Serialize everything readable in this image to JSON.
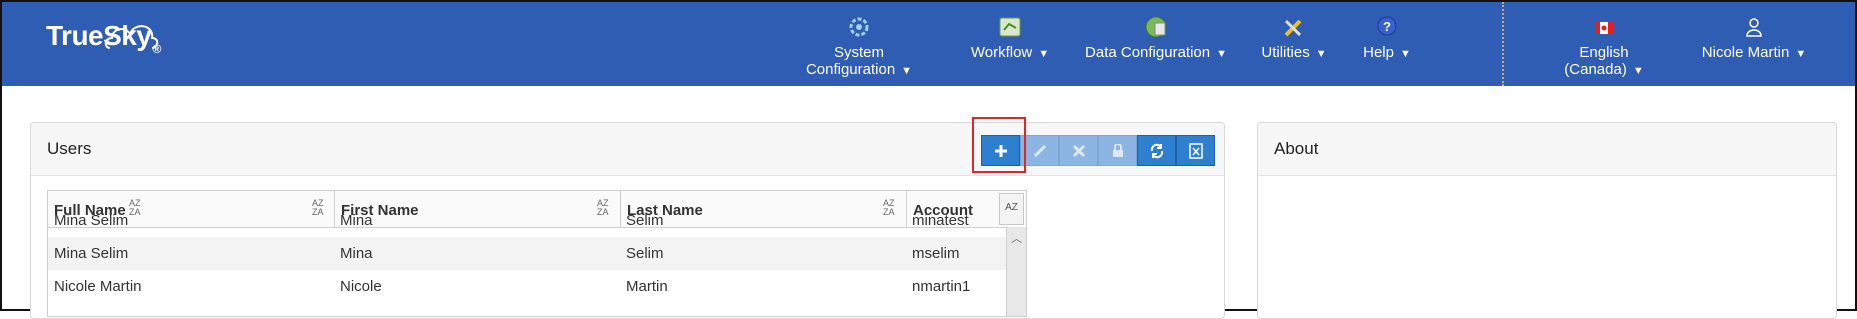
{
  "brand": {
    "name": "TrueSky",
    "reg": "®"
  },
  "nav": [
    {
      "label": "System Configuration",
      "icon": "gear-clock-icon"
    },
    {
      "label": "Workflow",
      "icon": "workflow-icon"
    },
    {
      "label": "Data Configuration",
      "icon": "database-globe-icon"
    },
    {
      "label": "Utilities",
      "icon": "tools-icon"
    },
    {
      "label": "Help",
      "icon": "help-icon"
    }
  ],
  "language": {
    "label": "English (Canada)",
    "icon": "canada-flag-icon"
  },
  "user": {
    "label": "Nicole Martin",
    "icon": "user-icon"
  },
  "users_panel": {
    "title": "Users",
    "toolbar": [
      "add-icon",
      "edit-icon",
      "delete-icon",
      "lock-icon",
      "refresh-icon",
      "export-excel-icon"
    ],
    "columns": [
      "Full Name",
      "First Name",
      "Last Name",
      "Account"
    ],
    "partial_row": [
      "Mina Selim",
      "Mina",
      "Selim",
      "minatest"
    ],
    "rows": [
      [
        "Mina Selim",
        "Mina",
        "Selim",
        "mselim"
      ],
      [
        "Nicole Martin",
        "Nicole",
        "Martin",
        "nmartin1"
      ]
    ]
  },
  "about_panel": {
    "title": "About"
  }
}
